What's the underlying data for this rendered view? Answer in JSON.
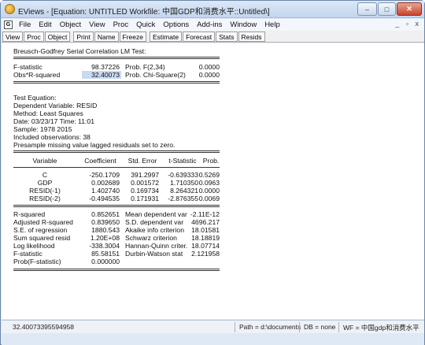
{
  "window": {
    "title": "EViews - [Equation: UNTITLED   Workfile: 中国GDP和消费水平::Untitled\\]",
    "min_icon": "minimize-icon",
    "max_icon": "maximize-icon",
    "close_icon": "close-icon",
    "min_glyph": "–",
    "max_glyph": "□",
    "close_glyph": "✕"
  },
  "menubar": {
    "logo": "G",
    "items": [
      "File",
      "Edit",
      "Object",
      "View",
      "Proc",
      "Quick",
      "Options",
      "Add-ins",
      "Window",
      "Help"
    ],
    "mdi_controls": "_ ▫ x"
  },
  "toolbar": {
    "buttons": [
      "View",
      "Proc",
      "Object",
      "Print",
      "Name",
      "Freeze",
      "Estimate",
      "Forecast",
      "Stats",
      "Resids"
    ]
  },
  "output": {
    "heading": "Breusch-Godfrey Serial Correlation LM Test:",
    "lm_test": [
      {
        "label": "F-statistic",
        "value": "98.37226",
        "prob_label": "Prob. F(2,34)",
        "prob": "0.0000"
      },
      {
        "label": "Obs*R-squared",
        "value": "32.40073",
        "prob_label": "Prob. Chi-Square(2)",
        "prob": "0.0000"
      }
    ],
    "info": [
      "Test Equation:",
      "Dependent Variable: RESID",
      "Method: Least Squares",
      "Date: 03/23/17   Time: 11:01",
      "Sample: 1978 2015",
      "Included observations: 38",
      "Presample missing value lagged residuals set to zero."
    ],
    "coef_headers": [
      "Variable",
      "Coefficient",
      "Std. Error",
      "t-Statistic",
      "Prob."
    ],
    "coef_rows": [
      [
        "C",
        "-250.1709",
        "391.2997",
        "-0.639333",
        "0.5269"
      ],
      [
        "GDP",
        "0.002689",
        "0.001572",
        "1.710350",
        "0.0963"
      ],
      [
        "RESID(-1)",
        "1.402740",
        "0.169734",
        "8.264321",
        "0.0000"
      ],
      [
        "RESID(-2)",
        "-0.494535",
        "0.171931",
        "-2.876355",
        "0.0069"
      ]
    ],
    "stats_rows": [
      [
        "R-squared",
        "0.852651",
        "Mean dependent var",
        "-2.11E-12"
      ],
      [
        "Adjusted R-squared",
        "0.839650",
        "S.D. dependent var",
        "4696.217"
      ],
      [
        "S.E. of regression",
        "1880.543",
        "Akaike info criterion",
        "18.01581"
      ],
      [
        "Sum squared resid",
        "1.20E+08",
        "Schwarz criterion",
        "18.18819"
      ],
      [
        "Log likelihood",
        "-338.3004",
        "Hannan-Quinn criter.",
        "18.07714"
      ],
      [
        "F-statistic",
        "85.58151",
        "Durbin-Watson stat",
        "2.121958"
      ],
      [
        "Prob(F-statistic)",
        "0.000000",
        "",
        ""
      ]
    ]
  },
  "statusbar": {
    "value": "32.40073395594958",
    "path": "Path = d:\\documents",
    "db": "DB = none",
    "wf": "WF = 中国gdp和消费水平"
  }
}
